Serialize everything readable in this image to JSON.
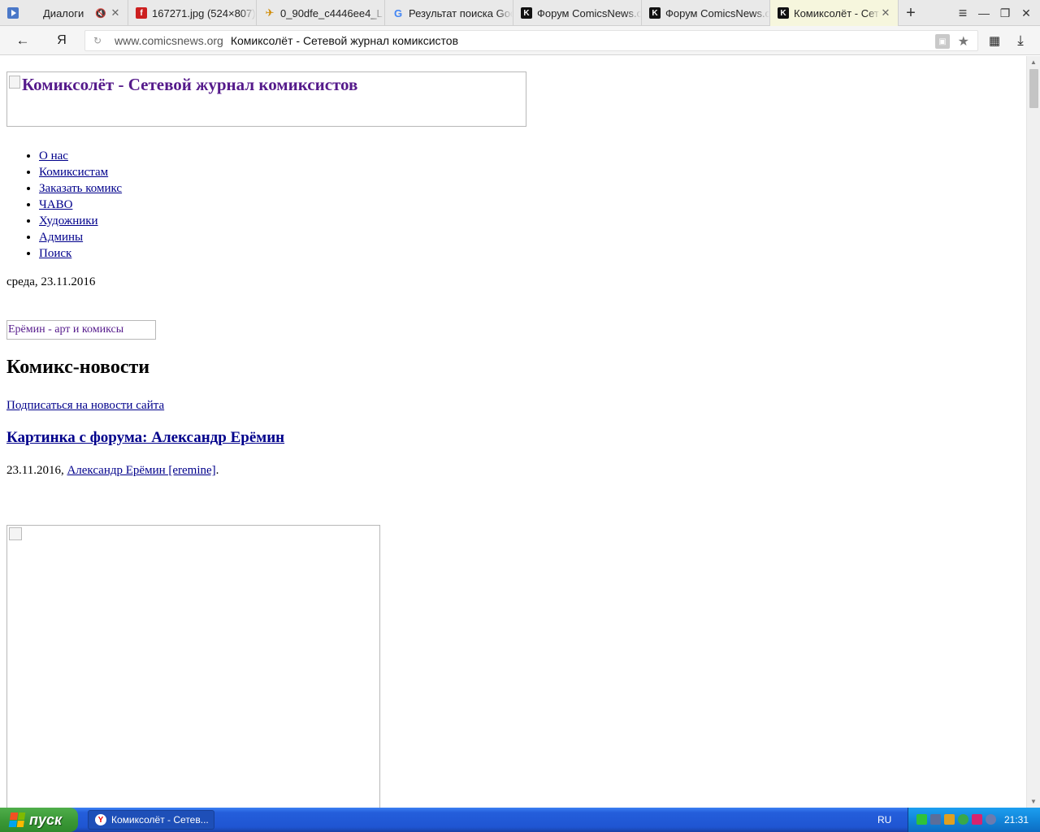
{
  "tabs": [
    {
      "title": "Диалоги",
      "favicon": "play-icon",
      "muted": true
    },
    {
      "title": "167271.jpg (524×807)",
      "favicon": "flash-icon"
    },
    {
      "title": "0_90dfe_c4446ee4_L",
      "favicon": "bird-icon"
    },
    {
      "title": "Результат поиска Google",
      "favicon": "google-icon",
      "favicon_char": "G"
    },
    {
      "title": "Форум ComicsNews.org",
      "favicon": "k-icon",
      "favicon_char": "K"
    },
    {
      "title": "Форум ComicsNews.org",
      "favicon": "k-icon",
      "favicon_char": "K"
    },
    {
      "title": "Комиксолёт - Сетевой журнал комиксистов",
      "favicon": "k-icon",
      "favicon_char": "K",
      "active": true
    }
  ],
  "browser": {
    "yandex_logo": "Я",
    "address_domain": "www.comicsnews.org",
    "address_title": "Комиксолёт - Сетевой журнал комиксистов"
  },
  "page": {
    "banner_alt": "Комиксолёт - Сетевой журнал комиксистов",
    "menu": [
      "О нас",
      "Комиксистам",
      "Заказать комикс",
      "ЧАВО",
      "Художники",
      "Админы",
      "Поиск"
    ],
    "date": "среда, 23.11.2016",
    "art_alt": "Ерёмин - арт и комиксы",
    "section_title": "Комикс-новости",
    "subscribe_link": "Подписаться на новости сайта",
    "post_title": "Картинка с форума: Александр Ерёмин",
    "post_date": "23.11.2016,",
    "post_author": "Александр Ерёмин [eremine]",
    "post_period": "."
  },
  "taskbar": {
    "start_label": "пуск",
    "window_item": "Комиксолёт - Сетев...",
    "lang": "RU",
    "clock": "21:31"
  }
}
